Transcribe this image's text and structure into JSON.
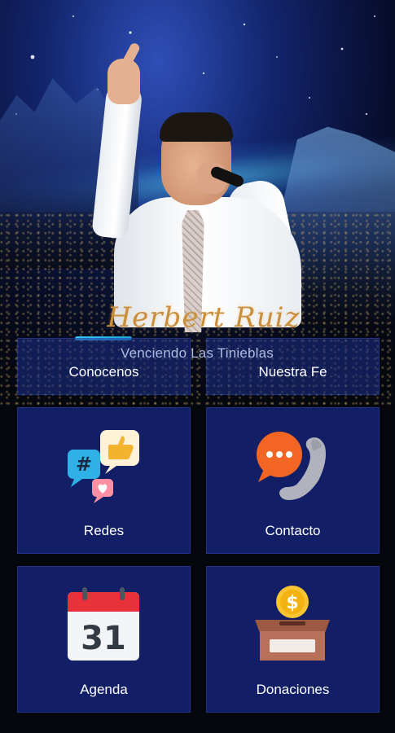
{
  "header": {
    "signature": "Herbert Ruiz",
    "tagline": "Venciendo Las Tinieblas"
  },
  "menu": {
    "conocenos": "Conocenos",
    "nuestra_fe": "Nuestra Fe",
    "redes": "Redes",
    "contacto": "Contacto",
    "agenda": "Agenda",
    "donaciones": "Donaciones"
  },
  "calendar": {
    "day": "31"
  },
  "icons": {
    "redes": "social-chat-bubbles-icon",
    "contacto": "phone-chat-icon",
    "agenda": "calendar-icon",
    "donaciones": "donation-box-coin-icon"
  },
  "colors": {
    "tile_bg": "#14226e",
    "accent": "#33c8ff",
    "signature": "#c98f3c"
  }
}
